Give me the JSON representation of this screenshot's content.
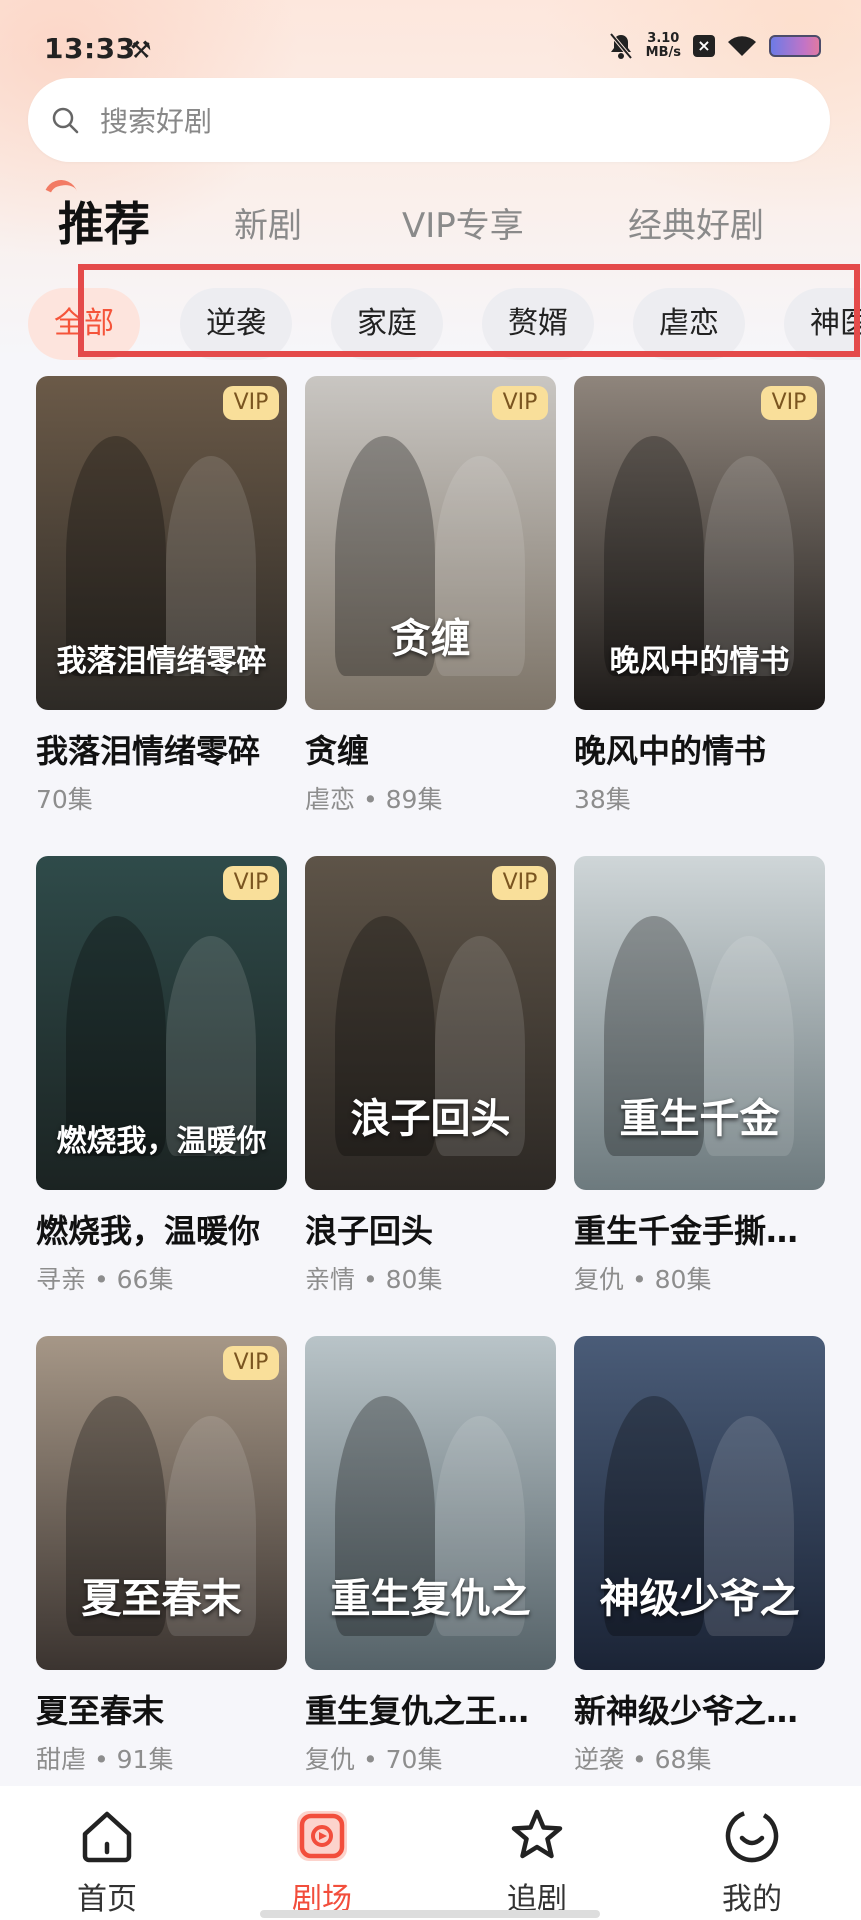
{
  "status_bar": {
    "time": "13:33",
    "speed": "3.10",
    "speed_unit": "MB/s"
  },
  "search": {
    "placeholder": "搜索好剧"
  },
  "tabs": [
    {
      "label": "推荐",
      "active": true
    },
    {
      "label": "新剧"
    },
    {
      "label": "VIP专享"
    },
    {
      "label": "经典好剧"
    }
  ],
  "categories": [
    {
      "label": "全部",
      "active": true
    },
    {
      "label": "逆袭"
    },
    {
      "label": "家庭"
    },
    {
      "label": "赘婿"
    },
    {
      "label": "虐恋"
    },
    {
      "label": "神医"
    }
  ],
  "vip_label": "VIP",
  "dramas": [
    {
      "title": "我落泪情绪零碎",
      "meta": "70集",
      "vip": true,
      "poster_text": "我落泪情绪零碎",
      "colors": [
        "#6b5a48",
        "#2d2a26"
      ]
    },
    {
      "title": "贪缠",
      "meta": "虐恋 • 89集",
      "vip": true,
      "poster_text": "贪缠",
      "colors": [
        "#c9c6c2",
        "#7d7468"
      ]
    },
    {
      "title": "晚风中的情书",
      "meta": "38集",
      "vip": true,
      "poster_text": "晚风中的情书",
      "colors": [
        "#8f857c",
        "#1e1b19"
      ]
    },
    {
      "title": "燃烧我，温暖你",
      "meta": "寻亲 • 66集",
      "vip": true,
      "poster_text": "燃烧我，温暖你",
      "colors": [
        "#2f4b4a",
        "#1b2322"
      ]
    },
    {
      "title": "浪子回头",
      "meta": "亲情 • 80集",
      "vip": true,
      "poster_text": "浪子回头",
      "colors": [
        "#5e5448",
        "#2c2824"
      ]
    },
    {
      "title": "重生千金手撕…",
      "meta": "复仇 • 80集",
      "vip": false,
      "poster_text": "重生千金",
      "colors": [
        "#cfd6d8",
        "#6d7a7e"
      ]
    },
    {
      "title": "夏至春末",
      "meta": "甜虐 • 91集",
      "vip": true,
      "poster_text": "夏至春末",
      "colors": [
        "#a69787",
        "#3b3430"
      ]
    },
    {
      "title": "重生复仇之王…",
      "meta": "复仇 • 70集",
      "vip": false,
      "poster_text": "重生复仇之",
      "colors": [
        "#b9c4c8",
        "#556268"
      ]
    },
    {
      "title": "新神级少爷之…",
      "meta": "逆袭 • 68集",
      "vip": false,
      "poster_text": "神级少爷之",
      "colors": [
        "#4a5c78",
        "#1b2436"
      ]
    }
  ],
  "bottom_nav": [
    {
      "label": "首页",
      "icon": "home-icon"
    },
    {
      "label": "剧场",
      "icon": "theater-icon",
      "active": true
    },
    {
      "label": "追剧",
      "icon": "star-icon"
    },
    {
      "label": "我的",
      "icon": "profile-icon"
    }
  ],
  "colors": {
    "accent": "#f24e3c",
    "vip_bg": "#f9df9a",
    "highlight_box": "#e44a4a"
  }
}
